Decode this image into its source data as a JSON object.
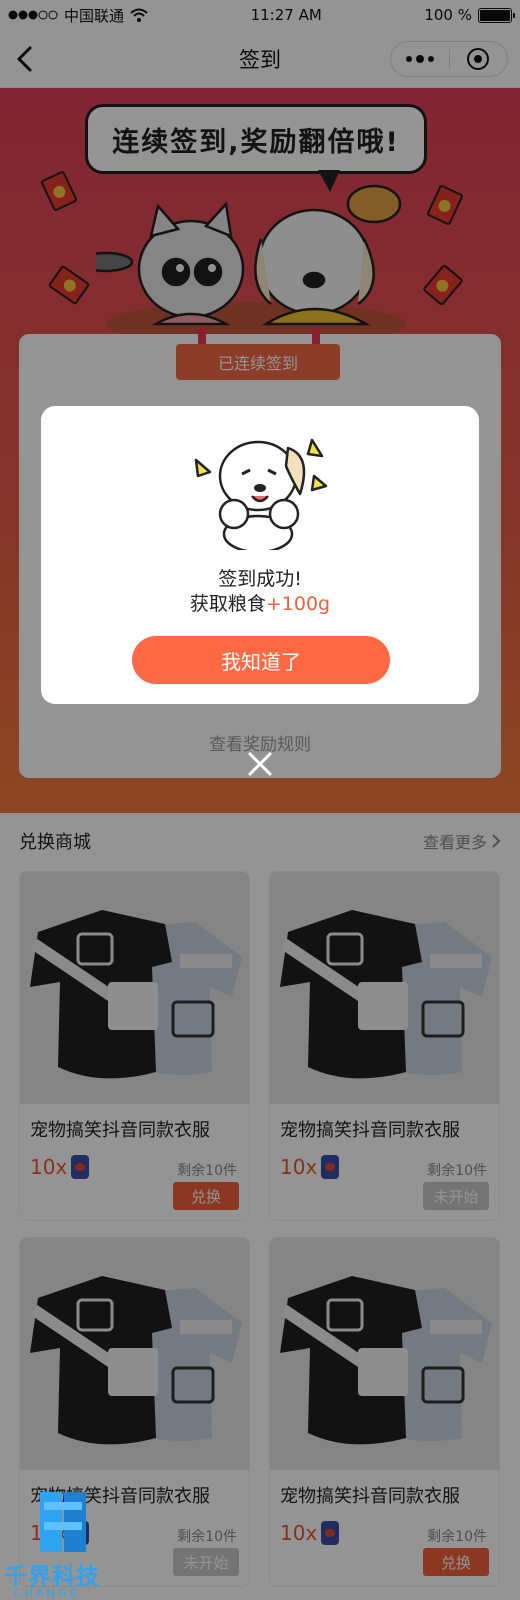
{
  "status_bar": {
    "carrier": "中国联通",
    "time": "11:27 AM",
    "battery": "100 %",
    "battery_level": 1.0
  },
  "nav": {
    "title": "签到"
  },
  "banner": {
    "slogan": "连续签到,奖励翻倍哦!"
  },
  "sign_card": {
    "tag": "已连续签到",
    "rules_link": "查看奖励规则"
  },
  "mall": {
    "title": "兑换商城",
    "more": "查看更多",
    "products": [
      {
        "name": "宠物搞笑抖音同款衣服",
        "price": "10x",
        "stock": "剩余10件",
        "button": "兑换",
        "state": "active"
      },
      {
        "name": "宠物搞笑抖音同款衣服",
        "price": "10x",
        "stock": "剩余10件",
        "button": "未开始",
        "state": "disabled"
      },
      {
        "name": "宠物搞笑抖音同款衣服",
        "price": "10x",
        "stock": "剩余10件",
        "button": "未开始",
        "state": "disabled"
      },
      {
        "name": "宠物搞笑抖音同款衣服",
        "price": "10x",
        "stock": "剩余10件",
        "button": "兑换",
        "state": "active"
      }
    ]
  },
  "modal": {
    "line1": "签到成功!",
    "line2_prefix": "获取粮食",
    "line2_highlight": "+100g",
    "button": "我知道了"
  },
  "watermark": {
    "text": "千界科技",
    "sub": "CHANGE"
  },
  "colors": {
    "accent": "#ff6a45",
    "banner_top": "#e0405a",
    "banner_bottom": "#f07a3a",
    "watermark": "#2fa3f0"
  },
  "icons": [
    "signal-dots-icon",
    "wifi-icon",
    "battery-icon",
    "back-arrow-icon",
    "more-dots-icon",
    "target-icon",
    "chevron-right-icon",
    "pet-food-can-icon",
    "close-icon",
    "red-envelope-icon"
  ]
}
